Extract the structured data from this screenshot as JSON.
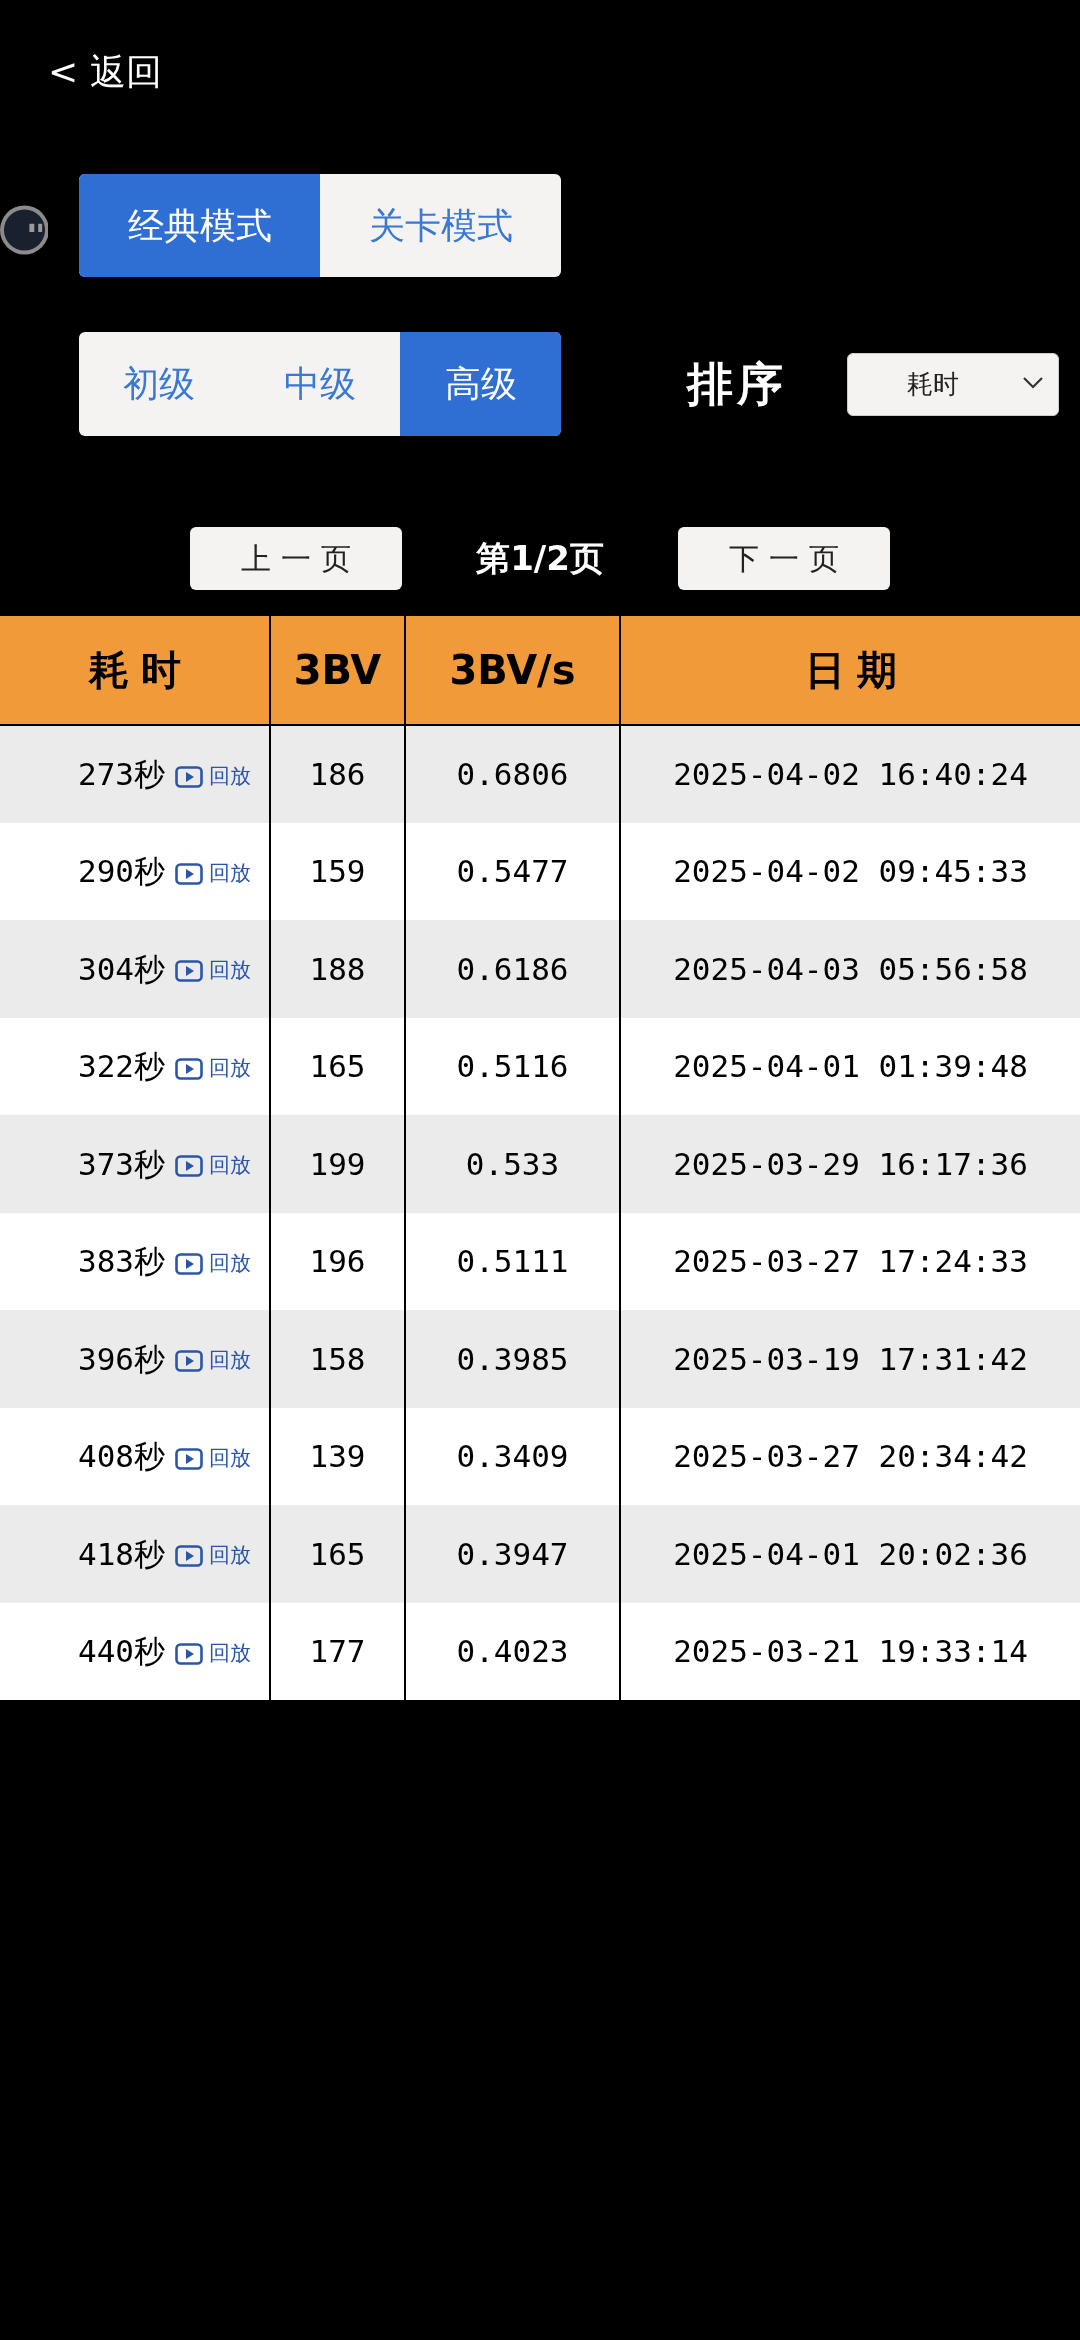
{
  "back_link": {
    "label": "< 返回"
  },
  "mode_tabs": [
    {
      "label": "经典模式",
      "selected": true
    },
    {
      "label": "关卡模式",
      "selected": false
    }
  ],
  "level_tabs": [
    {
      "label": "初级",
      "selected": false
    },
    {
      "label": "中级",
      "selected": false
    },
    {
      "label": "高级",
      "selected": true
    }
  ],
  "sort": {
    "label": "排序",
    "value": "耗时"
  },
  "pagination": {
    "previous": "上一页",
    "page": "第1/2页",
    "next": "下一页"
  },
  "table": {
    "columns": [
      "耗时",
      "3BV",
      "3BV/s",
      "日期"
    ],
    "rows": [
      {
        "time": "273秒",
        "replay": "回放",
        "bv": "186",
        "bv_per_s": "0.6806",
        "date": "2025-04-02 16:40:24"
      },
      {
        "time": "290秒",
        "replay": "回放",
        "bv": "159",
        "bv_per_s": "0.5477",
        "date": "2025-04-02 09:45:33"
      },
      {
        "time": "304秒",
        "replay": "回放",
        "bv": "188",
        "bv_per_s": "0.6186",
        "date": "2025-04-03 05:56:58"
      },
      {
        "time": "322秒",
        "replay": "回放",
        "bv": "165",
        "bv_per_s": "0.5116",
        "date": "2025-04-01 01:39:48"
      },
      {
        "time": "373秒",
        "replay": "回放",
        "bv": "199",
        "bv_per_s": "0.533",
        "date": "2025-03-29 16:17:36"
      },
      {
        "time": "383秒",
        "replay": "回放",
        "bv": "196",
        "bv_per_s": "0.5111",
        "date": "2025-03-27 17:24:33"
      },
      {
        "time": "396秒",
        "replay": "回放",
        "bv": "158",
        "bv_per_s": "0.3985",
        "date": "2025-03-19 17:31:42"
      },
      {
        "time": "408秒",
        "replay": "回放",
        "bv": "139",
        "bv_per_s": "0.3409",
        "date": "2025-03-27 20:34:42"
      },
      {
        "time": "418秒",
        "replay": "回放",
        "bv": "165",
        "bv_per_s": "0.3947",
        "date": "2025-04-01 20:02:36"
      },
      {
        "time": "440秒",
        "replay": "回放",
        "bv": "177",
        "bv_per_s": "0.4023",
        "date": "2025-03-21 19:33:14"
      }
    ]
  }
}
